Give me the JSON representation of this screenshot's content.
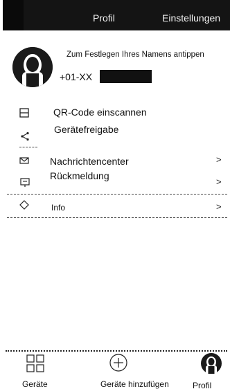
{
  "header": {
    "title": "Profil",
    "settings_label": "Einstellungen"
  },
  "profile": {
    "name_prompt": "Zum Festlegen Ihres Namens antippen",
    "phone": "+01-XX"
  },
  "menu": {
    "qr": "QR-Code einscannen",
    "share": "Gerätefreigabe",
    "messages": "Nachrichtencenter",
    "feedback": "Rückmeldung",
    "info": "Info",
    "chevron": ">"
  },
  "bottom_nav": {
    "devices": "Geräte",
    "add": "Geräte hinzufügen",
    "profile": "Profil"
  },
  "colors": {
    "header_bg": "#141414",
    "accent": "#111111"
  }
}
